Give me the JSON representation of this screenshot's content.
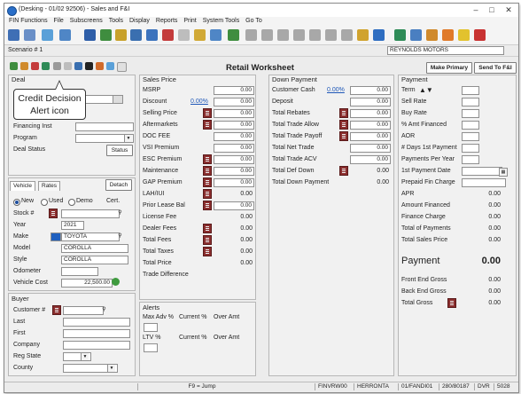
{
  "window": {
    "title": "(Desking - 01/02 92506) - Sales and F&I"
  },
  "menu": [
    "FIN Functions",
    "File",
    "Subscreens",
    "Tools",
    "Display",
    "Reports",
    "Print",
    "System Tools",
    "Go To"
  ],
  "scenario": {
    "label": "Scenario # 1",
    "dealer": "REYNOLDS MOTORS"
  },
  "worksheet": {
    "title": "Retail Worksheet",
    "make_primary": "Make Primary",
    "send_to_fi": "Send To F&I"
  },
  "callout": {
    "line1": "Credit Decision",
    "line2": "Alert icon"
  },
  "deal": {
    "heading": "Deal",
    "financing_inst": "Financing Inst",
    "program": "Program",
    "deal_status": "Deal Status",
    "status_button": "Status"
  },
  "vehicle": {
    "tabs": [
      "Vehicle",
      "Rates"
    ],
    "detach": "Detach",
    "radios": [
      "New",
      "Used",
      "Demo",
      "Cert."
    ],
    "stock_label": "Stock #",
    "year_label": "Year",
    "year": "2021",
    "make_label": "Make",
    "make": "TOYOTA",
    "model_label": "Model",
    "model": "COROLLA",
    "style_label": "Style",
    "style": "COROLLA",
    "odometer_label": "Odometer",
    "cost_label": "Vehicle Cost",
    "cost": "22,500.00"
  },
  "buyer": {
    "heading": "Buyer",
    "fields": [
      "Customer #",
      "Last",
      "First",
      "Company",
      "Reg State",
      "County"
    ]
  },
  "sales_price": {
    "heading": "Sales Price",
    "rows": [
      {
        "label": "MSRP",
        "value": "0.00"
      },
      {
        "label": "Discount",
        "pct": "0.00%",
        "value": "0.00"
      },
      {
        "label": "Selling Price",
        "value": "0.00"
      },
      {
        "label": "Aftermarkets",
        "value": "0.00"
      },
      {
        "label": "DOC FEE",
        "value": "0.00"
      },
      {
        "label": "VSI Premium",
        "value": "0.00"
      },
      {
        "label": "ESC Premium",
        "value": "0.00"
      },
      {
        "label": "Maintenance",
        "value": "0.00"
      },
      {
        "label": "GAP Premium",
        "value": "0.00"
      },
      {
        "label": "LAH/IUI",
        "value": "0.00"
      },
      {
        "label": "Prior Lease Bal",
        "value": "0.00"
      },
      {
        "label": "License Fee",
        "value": "0.00"
      },
      {
        "label": "Dealer Fees",
        "value": "0.00"
      },
      {
        "label": "Total Fees",
        "value": "0.00"
      },
      {
        "label": "Total Taxes",
        "value": "0.00"
      },
      {
        "label": "Total Price",
        "value": "0.00"
      },
      {
        "label": "Trade Difference",
        "value": ""
      }
    ]
  },
  "alerts": {
    "heading": "Alerts",
    "row1": [
      "Max Adv %",
      "Current %",
      "Over Amt"
    ],
    "row2": [
      "LTV %",
      "Current %",
      "Over Amt"
    ]
  },
  "down_payment": {
    "heading": "Down Payment",
    "rows": [
      {
        "label": "Customer Cash",
        "pct": "0.00%",
        "value": "0.00"
      },
      {
        "label": "Deposit",
        "value": "0.00"
      },
      {
        "label": "Total Rebates",
        "value": "0.00"
      },
      {
        "label": "Total Trade Allow",
        "value": "0.00"
      },
      {
        "label": "Total Trade Payoff",
        "value": "0.00"
      },
      {
        "label": "Total Net Trade",
        "value": "0.00"
      },
      {
        "label": "Total Trade ACV",
        "value": "0.00"
      },
      {
        "label": "Total Def Down",
        "value": "0.00"
      },
      {
        "label": "Total Down Payment",
        "value": "0.00"
      }
    ]
  },
  "payment": {
    "heading": "Payment",
    "rows": [
      "Term",
      "Sell Rate",
      "Buy Rate",
      "% Amt Financed",
      "AOR",
      "# Days 1st Payment",
      "Payments Per Year",
      "1st Payment Date",
      "Prepaid Fin Charge"
    ],
    "totals": [
      {
        "label": "APR",
        "value": "0.00"
      },
      {
        "label": "Amount Financed",
        "value": "0.00"
      },
      {
        "label": "Finance Charge",
        "value": "0.00"
      },
      {
        "label": "Total of Payments",
        "value": "0.00"
      },
      {
        "label": "Total Sales Price",
        "value": "0.00"
      }
    ],
    "payment_label": "Payment",
    "payment_value": "0.00",
    "gross": [
      {
        "label": "Front End Gross",
        "value": "0.00"
      },
      {
        "label": "Back End Gross",
        "value": "0.00"
      },
      {
        "label": "Total Gross",
        "value": "0.00"
      }
    ]
  },
  "status": {
    "hint": "F9 = Jump",
    "cells": [
      "FINVRW00",
      "HERRONTA",
      "01/FANDI01",
      "280/80187",
      "DVR",
      "5028"
    ]
  }
}
